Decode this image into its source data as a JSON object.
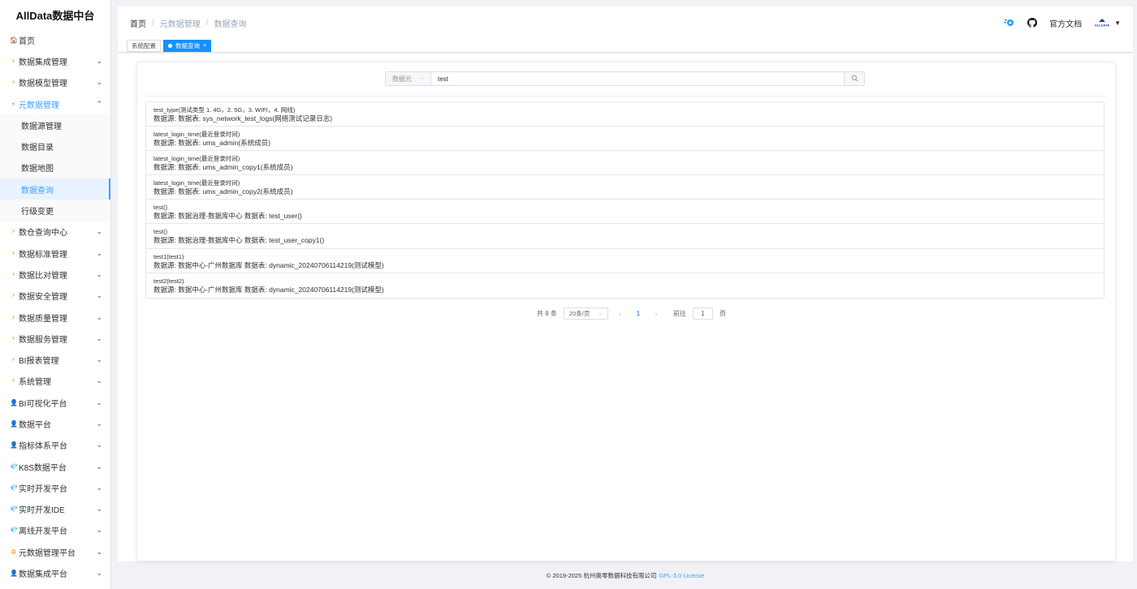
{
  "app": {
    "title": "AllData数据中台"
  },
  "sidebar": {
    "items": [
      {
        "label": "首页",
        "icon": "🏠",
        "expandable": false
      },
      {
        "label": "数据集成管理",
        "icon": "⚡",
        "expandable": true
      },
      {
        "label": "数据模型管理",
        "icon": "⚡",
        "expandable": true
      },
      {
        "label": "元数据管理",
        "icon": "⚡",
        "expandable": true,
        "open": true,
        "children": [
          "数据源管理",
          "数据目录",
          "数据地图",
          "数据查询",
          "行级变更"
        ],
        "active_child": "数据查询"
      },
      {
        "label": "数仓查询中心",
        "icon": "⚡",
        "expandable": true
      },
      {
        "label": "数据标准管理",
        "icon": "⚡",
        "expandable": true
      },
      {
        "label": "数据比对管理",
        "icon": "⚡",
        "expandable": true
      },
      {
        "label": "数据安全管理",
        "icon": "⚡",
        "expandable": true
      },
      {
        "label": "数据质量管理",
        "icon": "⚡",
        "expandable": true
      },
      {
        "label": "数据服务管理",
        "icon": "⚡",
        "expandable": true
      },
      {
        "label": "BI报表管理",
        "icon": "⚡",
        "expandable": true
      },
      {
        "label": "系统管理",
        "icon": "⚡",
        "expandable": true
      },
      {
        "label": "BI可视化平台",
        "icon": "👤",
        "expandable": true
      },
      {
        "label": "数据平台",
        "icon": "👤",
        "expandable": true
      },
      {
        "label": "指标体系平台",
        "icon": "👤",
        "expandable": true
      },
      {
        "label": "K8S数据平台",
        "icon": "💎",
        "expandable": true
      },
      {
        "label": "实时开发平台",
        "icon": "💎",
        "expandable": true
      },
      {
        "label": "实时开发IDE",
        "icon": "💎",
        "expandable": true
      },
      {
        "label": "离线开发平台",
        "icon": "💎",
        "expandable": true
      },
      {
        "label": "元数据管理平台",
        "icon": "♻",
        "expandable": true
      },
      {
        "label": "数据集成平台",
        "icon": "👤",
        "expandable": true
      }
    ]
  },
  "header": {
    "breadcrumb": [
      "首页",
      "元数据管理",
      "数据查询"
    ],
    "docs_label": "官方文档",
    "avatar_text": "ALLDATA"
  },
  "tags": [
    {
      "label": "系统配置",
      "active": false
    },
    {
      "label": "数据查询",
      "active": true
    }
  ],
  "search": {
    "select_value": "数据元",
    "input_value": "test"
  },
  "results": [
    {
      "title": "test_type(测试类型 1. 4G，2. 5G，3. WIFI，4. 网线)",
      "sub": "数据源: 数据表: sys_network_test_logs(网络测试记录日志)"
    },
    {
      "title": "latest_login_time(最近登录时间)",
      "sub": "数据源: 数据表: ums_admin(系统成员)"
    },
    {
      "title": "latest_login_time(最近登录时间)",
      "sub": "数据源: 数据表: ums_admin_copy1(系统成员)"
    },
    {
      "title": "latest_login_time(最近登录时间)",
      "sub": "数据源: 数据表: ums_admin_copy2(系统成员)"
    },
    {
      "title": "test()",
      "sub": "数据源: 数据治理-数据库中心 数据表: test_user()"
    },
    {
      "title": "test()",
      "sub": "数据源: 数据治理-数据库中心 数据表: test_user_copy1()"
    },
    {
      "title": "test1(test1)",
      "sub": "数据源: 数据中心-广州数据库 数据表: dynamic_20240706114219(测试模型)"
    },
    {
      "title": "test2(test2)",
      "sub": "数据源: 数据中心-广州数据库 数据表: dynamic_20240706114219(测试模型)"
    }
  ],
  "pagination": {
    "total_label": "共 8 条",
    "page_size": "20条/页",
    "current_page": "1",
    "goto_label": "前往",
    "goto_value": "1",
    "page_unit": "页"
  },
  "footer": {
    "copyright": "© 2019-2025 杭州奥零数据科技有限公司",
    "license": "GPL-3.0 License"
  },
  "colors": {
    "accent": "#409eff",
    "tag_active": "#1890ff"
  }
}
